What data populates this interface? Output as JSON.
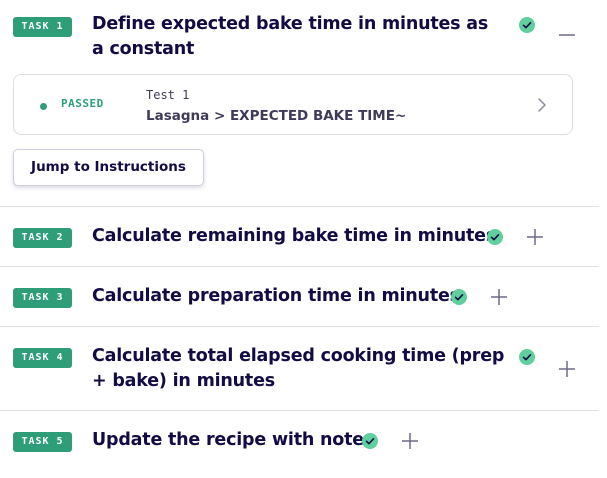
{
  "tasks": [
    {
      "badge": "TASK 1",
      "title": "Define expected bake time in minutes as a constant",
      "expanded": true
    },
    {
      "badge": "TASK 2",
      "title": "Calculate remaining bake time in minutes"
    },
    {
      "badge": "TASK 3",
      "title": "Calculate preparation time in minutes"
    },
    {
      "badge": "TASK 4",
      "title": "Calculate total elapsed cooking time (prep + bake) in minutes"
    },
    {
      "badge": "TASK 5",
      "title": "Update the recipe with notes"
    }
  ],
  "test": {
    "status": "PASSED",
    "number": "Test 1",
    "name": "Lasagna > EXPECTED BAKE TIME~"
  },
  "jump_label": "Jump to Instructions",
  "colors": {
    "badge": "#2e9e78",
    "check": "#5fcf9e",
    "text": "#130b43",
    "divider": "#e2e1ea"
  },
  "icons": {
    "check": "check-circle-icon",
    "collapse": "minus-icon",
    "expand": "plus-icon",
    "chevron": "chevron-right-icon"
  }
}
